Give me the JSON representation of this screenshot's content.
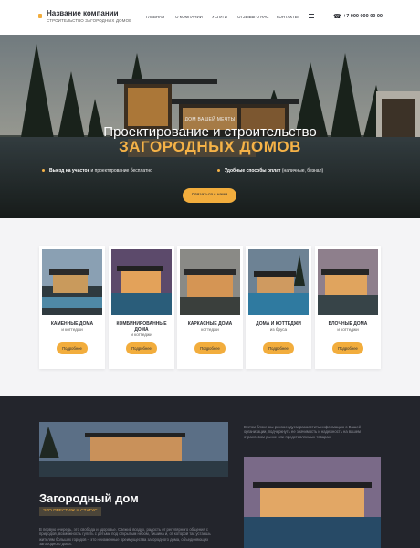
{
  "header": {
    "company_name": "Название компании",
    "company_tagline": "СТРОИТЕЛЬСТВО ЗАГОРОДНЫХ ДОМОВ",
    "nav": [
      "Главная",
      "О компании",
      "Услуги",
      "Отзывы о нас",
      "Контакты"
    ],
    "phone": "+7 000 000 00 00"
  },
  "hero": {
    "small_title": "ДОМ ВАШЕЙ МЕЧТЫ",
    "title_line1": "Проектирование и строительство",
    "title_line2": "загородных домов",
    "feature1_bold": "Выезд на участок",
    "feature1_rest": " и проектирование бесплатно",
    "feature2_bold": "Удобные способы оплат",
    "feature2_rest": " (наличные, безнал)",
    "button": "Связаться с нами"
  },
  "cards": [
    {
      "title": "Каменные дома",
      "subtitle": "и коттеджи",
      "button": "Подробнее"
    },
    {
      "title": "Комбинированные дома",
      "subtitle": "и коттеджи",
      "button": "Подробнее"
    },
    {
      "title": "Каркасные дома",
      "subtitle": "коттеджи",
      "button": "Подробнее"
    },
    {
      "title": "Дома и коттеджи",
      "subtitle": "из бруса",
      "button": "Подробнее"
    },
    {
      "title": "Блочные дома",
      "subtitle": "и коттеджи",
      "button": "Подробнее"
    }
  ],
  "about": {
    "side_text": "В этом блоке мы рекомендуем разместить информацию о Вашей организации, подчеркнуть ее значимость и надежность на вашем отраслевом рынке или представляемых товарах.",
    "title": "Загородный дом",
    "badge": "ЭТО ПРЕСТИЖ И СТАТУС",
    "paragraph": "В первую очередь, это свобода и здоровье. Свежий воздух, радость от регулярного общения с природой, возможность гулять с детьми под открытым небом, тишина и, от которой так устаешь жителям больших городов – это неизменные преимущества загородного дома, объединяющих загородного дома."
  },
  "colors": {
    "accent": "#f2ad3d",
    "dark_bg": "#23252c",
    "light_bg": "#f4f4f6"
  }
}
